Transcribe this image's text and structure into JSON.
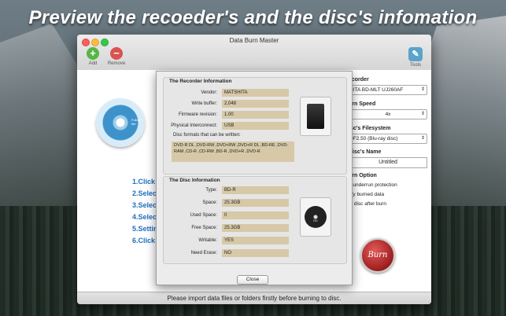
{
  "headline": "Preview the recoeder's and the disc's infomation",
  "window": {
    "title": "Data Burn Master"
  },
  "toolbar": {
    "add_label": "Add",
    "remove_label": "Remove",
    "tools_label": "Tools"
  },
  "disc_art": {
    "label": "Follow Me"
  },
  "steps": [
    "1.Click \"",
    "2.Select",
    "3.Select",
    "4.Select",
    "5.Settin",
    "6.Click \""
  ],
  "status_bar": "Please import data files or folders firstly before burning to disc.",
  "settings": {
    "recorder_label": "ecorder",
    "recorder_value": "HITA BD-MLT UJ260AF",
    "burn_speed_label": "urn Speed",
    "burn_speed_value": "4x",
    "filesystem_label": "isc's Filesystem",
    "filesystem_value": "DF2.50 (Blu-ray disc)",
    "disc_name_label": "Disc's Name",
    "disc_name_value": "Untitled",
    "burn_option_label": "urn Option",
    "options": [
      "n underrun protection",
      "rify burned data",
      "ct disc after burn"
    ]
  },
  "burn_button": "Burn",
  "sheet": {
    "recorder_title": "The Recorder Information",
    "recorder_rows": [
      {
        "label": "Vendor:",
        "value": "MATSHITA"
      },
      {
        "label": "Write buffer:",
        "value": "2,048"
      },
      {
        "label": "Firmware revision:",
        "value": "1.00"
      },
      {
        "label": "Physical Interconnect:",
        "value": "USB"
      }
    ],
    "formats_label": "Disc formats that can be written:",
    "formats_value": "DVD-R DL ,DVD-RW ,DVD+RW ,DVD+R DL ,BD-RE ,DVD-RAM ,CD-R ,CD-RW ,BD-R ,DVD+R ,DVD-R",
    "disc_title": "The Disc Information",
    "disc_rows": [
      {
        "label": "Type:",
        "value": "BD-R"
      },
      {
        "label": "Space:",
        "value": "25.3GB"
      },
      {
        "label": "Used Space:",
        "value": "0"
      },
      {
        "label": "Free Space:",
        "value": "25.3GB"
      },
      {
        "label": "Writable:",
        "value": "YES"
      },
      {
        "label": "Need Erase:",
        "value": "NO"
      }
    ],
    "bd_label": "BD",
    "close_label": "Close"
  }
}
